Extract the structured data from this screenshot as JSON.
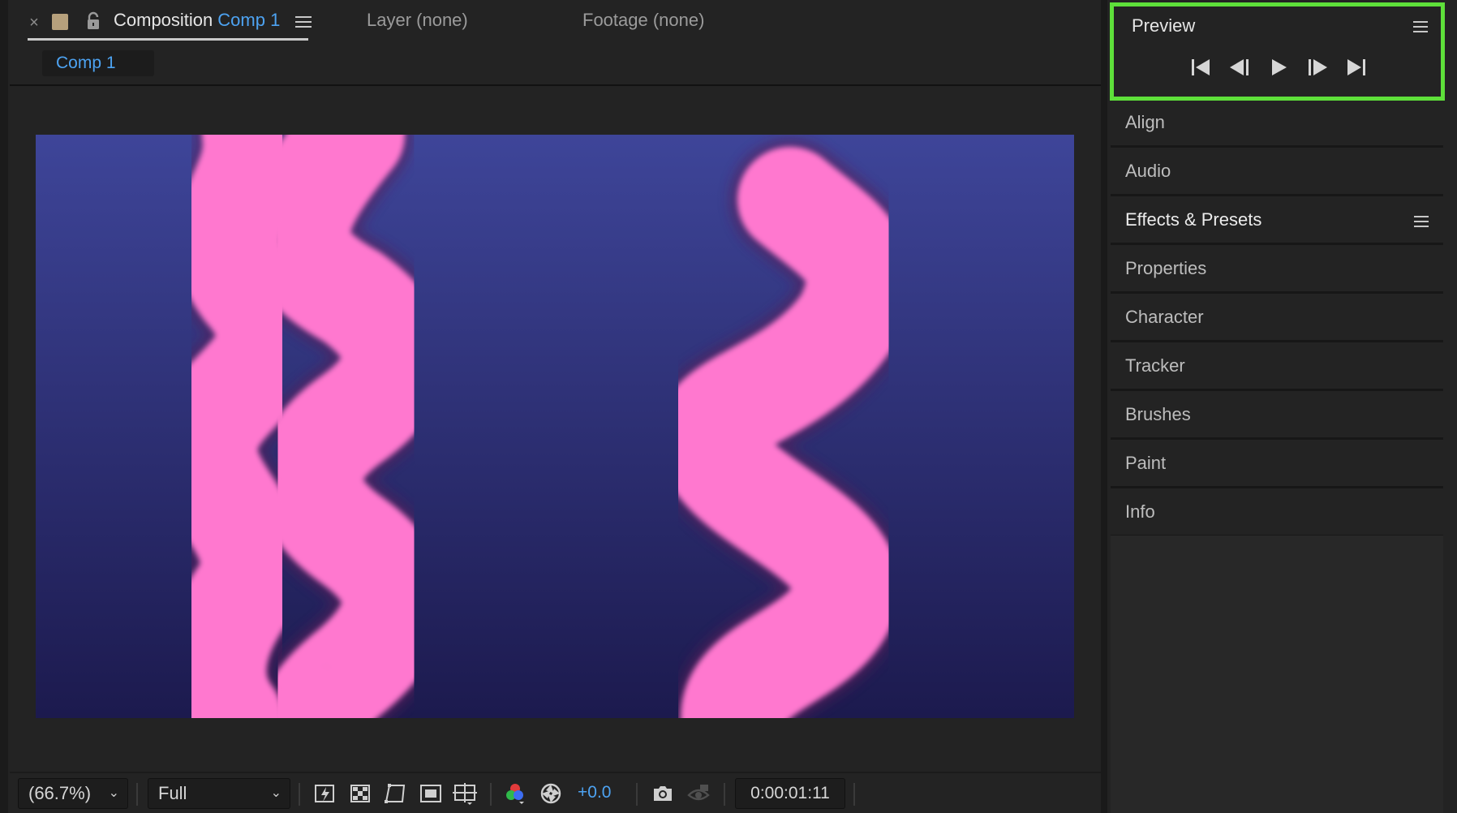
{
  "composition_panel": {
    "tabs": {
      "close_glyph": "×",
      "active_prefix": "Composition",
      "active_comp_name": "Comp 1",
      "layer_tab": "Layer (none)",
      "footage_tab": "Footage (none)"
    },
    "subtab": "Comp 1",
    "canvas": {
      "background_top": "#3e4599",
      "background_bottom": "#1c1a4e",
      "wave_color": "#ff78cf"
    }
  },
  "toolbar": {
    "zoom": "(66.7%)",
    "resolution": "Full",
    "exposure": "+0.0",
    "timecode": "0:00:01:11"
  },
  "right_panels": {
    "preview": {
      "title": "Preview",
      "highlight_color": "#5ee03a"
    },
    "rows": [
      {
        "label": "Align",
        "active": false
      },
      {
        "label": "Audio",
        "active": false
      },
      {
        "label": "Effects & Presets",
        "active": true
      },
      {
        "label": "Properties",
        "active": false
      },
      {
        "label": "Character",
        "active": false
      },
      {
        "label": "Tracker",
        "active": false
      },
      {
        "label": "Brushes",
        "active": false
      },
      {
        "label": "Paint",
        "active": false
      },
      {
        "label": "Info",
        "active": false
      }
    ]
  }
}
